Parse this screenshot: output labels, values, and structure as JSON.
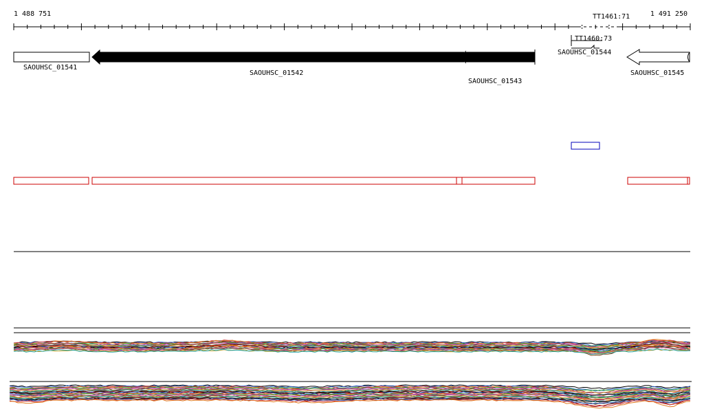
{
  "browser": {
    "range_start_label": "1 488 751",
    "range_end_label": "1 491 250"
  },
  "genes": [
    {
      "id": "gene-01541",
      "label": "SAOUHSC_01541",
      "direction": "right",
      "fill": "#ffffff"
    },
    {
      "id": "gene-01542",
      "label": "SAOUHSC_01542",
      "direction": "left",
      "fill": "#000000"
    },
    {
      "id": "gene-01543",
      "label": "SAOUHSC_01543",
      "direction": "left",
      "fill": "#000000"
    },
    {
      "id": "gene-01544",
      "label": "SAOUHSC_01544",
      "direction": "right",
      "fill": "#ffffff"
    },
    {
      "id": "gene-01545",
      "label": "SAOUHSC_01545",
      "direction": "left",
      "fill": "#ffffff"
    }
  ],
  "terminators": [
    {
      "label": "TT1461:71"
    },
    {
      "label": "TT1460:73"
    }
  ],
  "feature_colors": {
    "red_boxes": "#cc0000",
    "blue_box": "#0000bb"
  },
  "expression_tracks": {
    "colors": [
      "#000000",
      "#3366cc",
      "#cc3333",
      "#e07a1f",
      "#2e9e2e",
      "#9933aa",
      "#e06aa8",
      "#7a4a1f",
      "#c9a227",
      "#1fa0a0",
      "#666666",
      "#8b0000"
    ]
  }
}
